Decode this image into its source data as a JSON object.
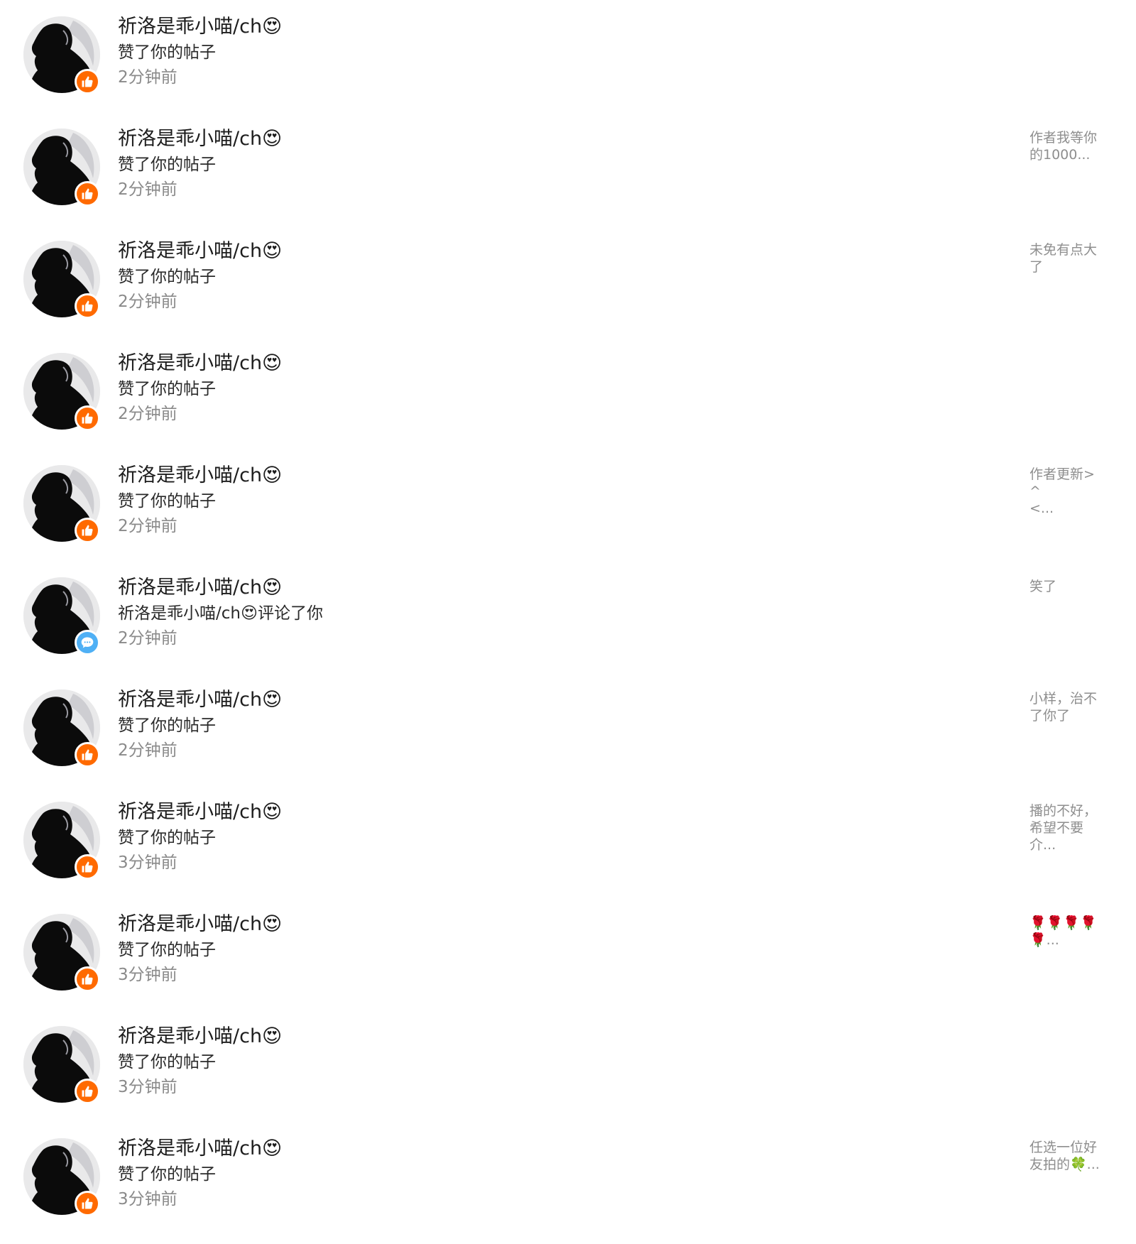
{
  "colors": {
    "like_badge": "#ff6a00",
    "comment_badge": "#4fb0f5",
    "time_text": "#8a8a8a",
    "preview_text": "#8e8e8e"
  },
  "notifications": [
    {
      "user": "祈洛是乖小喵/ch😍",
      "action": "赞了你的帖子",
      "time": "2分钟前",
      "badge_icon": "thumbs-up-icon",
      "preview": ""
    },
    {
      "user": "祈洛是乖小喵/ch😍",
      "action": "赞了你的帖子",
      "time": "2分钟前",
      "badge_icon": "thumbs-up-icon",
      "preview": "作者我等你\n的1000..."
    },
    {
      "user": "祈洛是乖小喵/ch😍",
      "action": "赞了你的帖子",
      "time": "2分钟前",
      "badge_icon": "thumbs-up-icon",
      "preview": "未免有点大\n了"
    },
    {
      "user": "祈洛是乖小喵/ch😍",
      "action": "赞了你的帖子",
      "time": "2分钟前",
      "badge_icon": "thumbs-up-icon",
      "preview": ""
    },
    {
      "user": "祈洛是乖小喵/ch😍",
      "action": "赞了你的帖子",
      "time": "2分钟前",
      "badge_icon": "thumbs-up-icon",
      "preview": "作者更新> ^\n<..."
    },
    {
      "user": "祈洛是乖小喵/ch😍",
      "action": "祈洛是乖小喵/ch😍评论了你",
      "time": "2分钟前",
      "badge_icon": "comment-bubble-icon",
      "preview": "笑了"
    },
    {
      "user": "祈洛是乖小喵/ch😍",
      "action": "赞了你的帖子",
      "time": "2分钟前",
      "badge_icon": "thumbs-up-icon",
      "preview": "小样，治不\n了你了"
    },
    {
      "user": "祈洛是乖小喵/ch😍",
      "action": "赞了你的帖子",
      "time": "3分钟前",
      "badge_icon": "thumbs-up-icon",
      "preview": "播的不好，\n希望不要\n介..."
    },
    {
      "user": "祈洛是乖小喵/ch😍",
      "action": "赞了你的帖子",
      "time": "3分钟前",
      "badge_icon": "thumbs-up-icon",
      "preview": "🌹🌹🌹🌹\n🌹..."
    },
    {
      "user": "祈洛是乖小喵/ch😍",
      "action": "赞了你的帖子",
      "time": "3分钟前",
      "badge_icon": "thumbs-up-icon",
      "preview": ""
    },
    {
      "user": "祈洛是乖小喵/ch😍",
      "action": "赞了你的帖子",
      "time": "3分钟前",
      "badge_icon": "thumbs-up-icon",
      "preview": "任选一位好\n友拍的🍀..."
    }
  ]
}
